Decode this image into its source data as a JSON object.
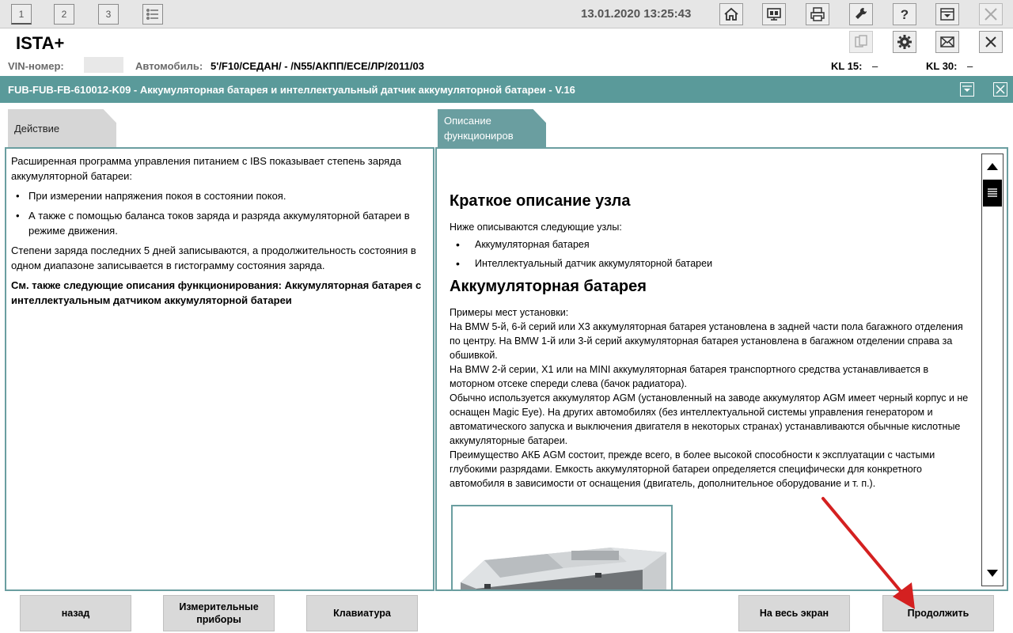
{
  "toolbar": {
    "window_buttons": [
      "1",
      "2",
      "3"
    ],
    "datetime": "13.01.2020 13:25:43",
    "icons": [
      "home-icon",
      "display-icon",
      "printer-icon",
      "wrench-icon",
      "help-icon",
      "minimize-icon",
      "close-icon"
    ]
  },
  "app": {
    "title": "ISTA+",
    "icons": [
      "document-icon",
      "gear-icon",
      "mail-icon",
      "close-icon"
    ]
  },
  "vehicle": {
    "vin_label": "VIN-номер:",
    "car_label": "Автомобиль:",
    "car_value": "5'/F10/СЕДАН/ - /N55/АКПП/ECE/ЛР/2011/03",
    "kl15_label": "KL 15:",
    "kl15_value": "–",
    "kl30_label": "KL 30:",
    "kl30_value": "–"
  },
  "document": {
    "title": "FUB-FUB-FB-610012-K09 - Аккумуляторная батарея и интеллектуальный датчик аккумуляторной батареи - V.16"
  },
  "tabs": {
    "left": "Действие",
    "right": "Описание функциониров"
  },
  "left_panel": {
    "intro": "Расширенная программа управления питанием с IBS показывает степень заряда аккумуляторной батареи:",
    "bullets": [
      "При измерении напряжения покоя в состоянии покоя.",
      "А также с помощью баланса токов заряда и разряда аккумуляторной батареи в режиме движения."
    ],
    "paragraph": "Степени заряда последних 5 дней записываются, а продолжительность состояния в одном диапазоне записывается в гистограмму состояния заряда.",
    "see_also": "См. также следующие описания функционирования: Аккумуляторная батарея с интеллектуальным датчиком аккумуляторной батареи"
  },
  "right_panel": {
    "heading1": "Краткое описание узла",
    "intro": "Ниже описываются следующие узлы:",
    "bullets": [
      "Аккумуляторная батарея",
      "Интеллектуальный датчик аккумуляторной батареи"
    ],
    "heading2": "Аккумуляторная батарея",
    "lines": [
      "Примеры мест установки:",
      "На BMW 5-й, 6-й серий или X3 аккумуляторная батарея установлена в задней части пола багажного отделения по центру. На BMW 1-й или 3-й серий аккумуляторная батарея установлена в багажном отделении справа за обшивкой.",
      "На BMW 2-й серии, X1 или на MINI аккумуляторная батарея транспортного средства устанавливается в моторном отсеке спереди слева (бачок радиатора).",
      "Обычно используется аккумулятор AGM (установленный на заводе аккумулятор AGM имеет черный корпус и не оснащен Magic Eye). На других автомобилях (без интеллектуальной системы управления генератором и автоматического запуска и выключения двигателя в некоторых странах) устанавливаются обычные кислотные аккумуляторные батареи.",
      "Преимущество АКБ AGM состоит, прежде всего, в более высокой способности к эксплуатации с частыми глубокими разрядами. Емкость аккумуляторной батареи определяется специфически для конкретного автомобиля в зависимости от оснащения (двигатель, дополнительное оборудование и т. п.)."
    ]
  },
  "buttons": {
    "back": "назад",
    "instruments": "Измерительные приборы",
    "keyboard": "Клавиатура",
    "fullscreen": "На весь экран",
    "continue": "Продолжить"
  },
  "colors": {
    "accent": "#5a9a9a",
    "annotation_arrow": "#d42020"
  }
}
